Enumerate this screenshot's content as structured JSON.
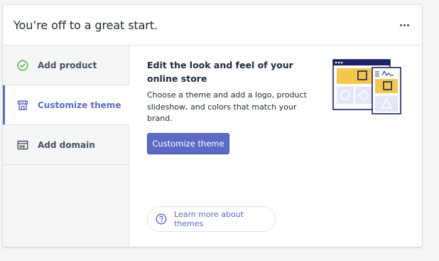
{
  "card": {
    "title": "You’re off to a great start.",
    "more_icon": "more-horizontal-icon"
  },
  "sidebar": {
    "items": [
      {
        "label": "Add product",
        "icon": "checkmark-circle-icon",
        "active": false
      },
      {
        "label": "Customize theme",
        "icon": "store-icon",
        "active": true
      },
      {
        "label": "Add domain",
        "icon": "domain-icon",
        "active": false
      }
    ]
  },
  "content": {
    "title": "Edit the look and feel of your online store",
    "description": "Choose a theme and add a logo, product slideshow, and colors that match your brand.",
    "primary_button": "Customize theme",
    "learn_more": "Learn more about themes"
  },
  "colors": {
    "accent": "#5c6ac4",
    "success": "#50b83c",
    "illustration_yellow": "#f4c84f",
    "illustration_navy": "#1c2260"
  }
}
